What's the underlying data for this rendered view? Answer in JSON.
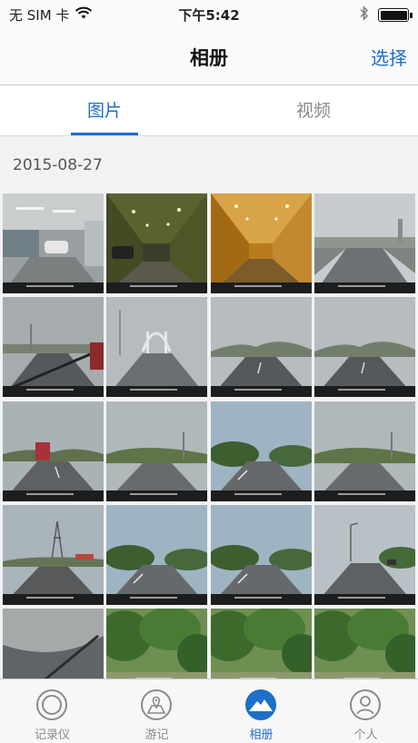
{
  "status_bar": {
    "carrier": "无 SIM 卡",
    "time": "下午5:42",
    "wifi_icon": "wifi-icon",
    "bluetooth_icon": "bluetooth-icon",
    "battery_level": 1.0
  },
  "nav": {
    "title": "相册",
    "action_label": "选择"
  },
  "segments": [
    {
      "label": "图片",
      "active": true
    },
    {
      "label": "视频",
      "active": false
    }
  ],
  "section": {
    "date": "2015-08-27"
  },
  "photos": [
    {
      "scene": "garage"
    },
    {
      "scene": "tunnel-green"
    },
    {
      "scene": "tunnel-orange"
    },
    {
      "scene": "highway-clear"
    },
    {
      "scene": "road-cloudy-wiper"
    },
    {
      "scene": "bridge-rain"
    },
    {
      "scene": "road-hills"
    },
    {
      "scene": "road-hills"
    },
    {
      "scene": "road-truck"
    },
    {
      "scene": "road-green"
    },
    {
      "scene": "road-trees"
    },
    {
      "scene": "road-green"
    },
    {
      "scene": "road-pylon"
    },
    {
      "scene": "road-trees"
    },
    {
      "scene": "road-trees"
    },
    {
      "scene": "road-lamp"
    },
    {
      "scene": "car-interior"
    },
    {
      "scene": "parking-trees"
    },
    {
      "scene": "parking-trees"
    },
    {
      "scene": "parking-trees"
    }
  ],
  "tab_bar": {
    "items": [
      {
        "label": "记录仪",
        "icon": "camera-ring-icon",
        "active": false
      },
      {
        "label": "游记",
        "icon": "map-pin-icon",
        "active": false
      },
      {
        "label": "相册",
        "icon": "mountain-album-icon",
        "active": true
      },
      {
        "label": "个人",
        "icon": "person-icon",
        "active": false
      }
    ]
  },
  "colors": {
    "accent": "#1d6fc7",
    "inactive": "#8a8a8a"
  }
}
